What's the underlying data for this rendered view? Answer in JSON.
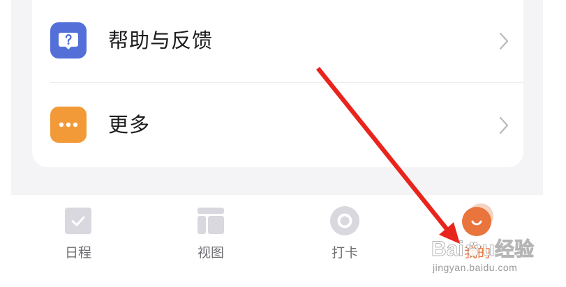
{
  "menu": {
    "items": [
      {
        "label": "帮助与反馈",
        "icon": "help-question-icon",
        "icon_color": "#5470d8"
      },
      {
        "label": "更多",
        "icon": "more-dots-icon",
        "icon_color": "#f29a38"
      }
    ]
  },
  "tabbar": {
    "tabs": [
      {
        "label": "日程",
        "icon": "checkbox-icon"
      },
      {
        "label": "视图",
        "icon": "layout-icon"
      },
      {
        "label": "打卡",
        "icon": "ring-icon"
      },
      {
        "label": "我的",
        "icon": "avatar-icon",
        "active": true
      }
    ]
  },
  "colors": {
    "accent": "#e9743c",
    "annotation_arrow": "#e8251c"
  },
  "watermark": {
    "logo_latin_1": "Bai",
    "logo_latin_2": "u",
    "logo_cn": "经验",
    "url": "jingyan.baidu.com"
  }
}
